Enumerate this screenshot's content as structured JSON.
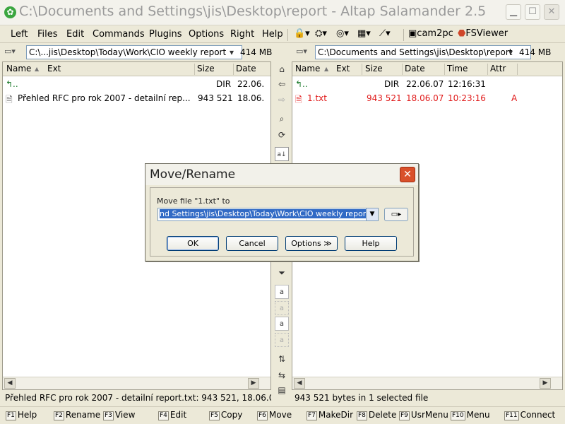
{
  "window": {
    "title": "C:\\Documents and Settings\\jis\\Desktop\\report - Altap Salamander 2.5",
    "min": "▁",
    "max": "☐",
    "close": "✕"
  },
  "menu": [
    "Left",
    "Files",
    "Edit",
    "Commands",
    "Plugins",
    "Options",
    "Right",
    "Help"
  ],
  "toolbar": {
    "cam2pc": "cam2pc",
    "fsviewer": "FSViewer"
  },
  "left_panel": {
    "path": "C:\\...jis\\Desktop\\Today\\Work\\CIO weekly report",
    "free": "414 MB",
    "columns": [
      "Name",
      "Ext",
      "Size",
      "Date"
    ],
    "rows": [
      {
        "name": "",
        "ext": "",
        "size": "DIR",
        "date": "22.06."
      },
      {
        "name": "Přehled RFC pro rok 2007 - detailní rep...",
        "ext": "",
        "size": "943 521",
        "date": "18.06."
      }
    ],
    "status": "Přehled RFC pro rok 2007 - detailní report.txt: 943 521, 18.06.0..."
  },
  "right_panel": {
    "path": "C:\\Documents and Settings\\jis\\Desktop\\report",
    "free": "414 MB",
    "columns": [
      "Name",
      "Ext",
      "Size",
      "Date",
      "Time",
      "Attr"
    ],
    "rows": [
      {
        "name": "",
        "ext": "",
        "size": "DIR",
        "date": "22.06.07",
        "time": "12:16:31",
        "attr": ""
      },
      {
        "name": "1.txt",
        "ext": "",
        "size": "943 521",
        "date": "18.06.07",
        "time": "10:23:16",
        "attr": "A"
      }
    ],
    "status": "943 521 bytes in 1 selected file"
  },
  "dialog": {
    "title": "Move/Rename",
    "label": "Move file \"1.txt\" to",
    "value": "nd Settings\\jis\\Desktop\\Today\\Work\\CIO weekly report\\*.*",
    "ok": "OK",
    "cancel": "Cancel",
    "options": "Options  ≫",
    "help": "Help"
  },
  "fkeys": [
    {
      "key": "F1",
      "label": "Help"
    },
    {
      "key": "F2",
      "label": "Rename"
    },
    {
      "key": "F3",
      "label": "View"
    },
    {
      "key": "F4",
      "label": "Edit"
    },
    {
      "key": "F5",
      "label": "Copy"
    },
    {
      "key": "F6",
      "label": "Move"
    },
    {
      "key": "F7",
      "label": "MakeDir"
    },
    {
      "key": "F8",
      "label": "Delete"
    },
    {
      "key": "F9",
      "label": "UsrMenu"
    },
    {
      "key": "F10",
      "label": "Menu"
    },
    {
      "key": "F11",
      "label": "Connect"
    }
  ],
  "colors": {
    "selected_file": "#e01a1a",
    "accent": "#316ac5"
  }
}
